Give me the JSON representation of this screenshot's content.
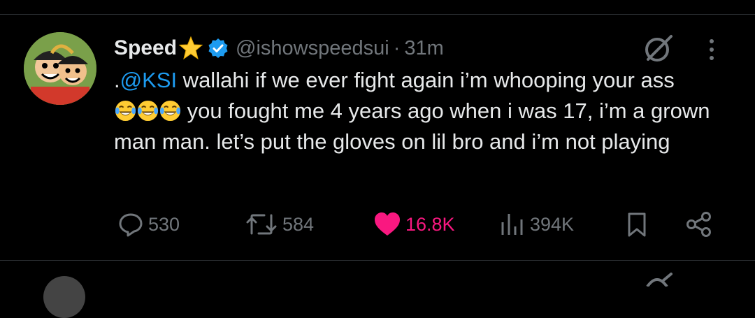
{
  "tweet": {
    "display_name": "Speed",
    "handle": "@ishowspeedsui",
    "separator": "·",
    "time": "31m",
    "text": {
      "prefix": ".",
      "mention": "@KSI",
      "line1_rest": " wallahi if we ever fight again i’m whooping your ass",
      "emoji_name": "face-with-tears-of-joy",
      "after_emojis": " you fought me 4 years ago when i was 17, i’m a grown man man. let’s put the gloves on lil bro and i’m not playing"
    },
    "stats": {
      "replies": "530",
      "reposts": "584",
      "likes": "16.8K",
      "views": "394K"
    }
  },
  "colors": {
    "background": "#000000",
    "text": "#e7e9ea",
    "muted": "#71767b",
    "link": "#1d9bf0",
    "like": "#f91880",
    "verified": "#1d9bf0",
    "star": "#ffcc33"
  },
  "icons": [
    "star-icon",
    "verified-badge-icon",
    "grok-icon",
    "more-icon",
    "reply-icon",
    "retweet-icon",
    "heart-icon",
    "views-icon",
    "bookmark-icon",
    "share-icon"
  ]
}
